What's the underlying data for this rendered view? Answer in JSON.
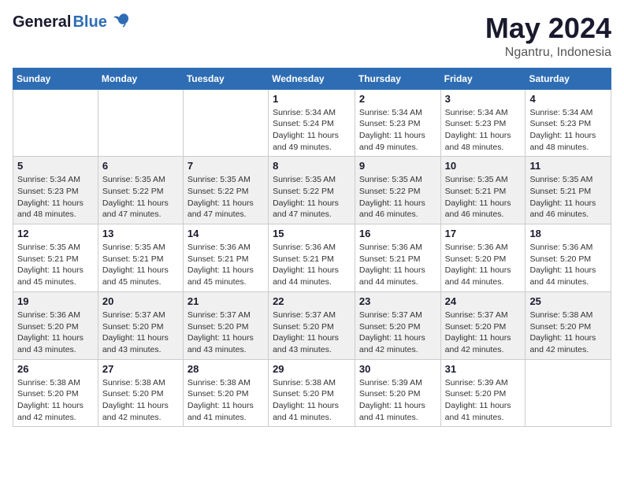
{
  "header": {
    "logo_general": "General",
    "logo_blue": "Blue",
    "month_title": "May 2024",
    "location": "Ngantru, Indonesia"
  },
  "days_of_week": [
    "Sunday",
    "Monday",
    "Tuesday",
    "Wednesday",
    "Thursday",
    "Friday",
    "Saturday"
  ],
  "weeks": [
    [
      {
        "day": "",
        "sunrise": "",
        "sunset": "",
        "daylight": ""
      },
      {
        "day": "",
        "sunrise": "",
        "sunset": "",
        "daylight": ""
      },
      {
        "day": "",
        "sunrise": "",
        "sunset": "",
        "daylight": ""
      },
      {
        "day": "1",
        "sunrise": "Sunrise: 5:34 AM",
        "sunset": "Sunset: 5:24 PM",
        "daylight": "Daylight: 11 hours and 49 minutes."
      },
      {
        "day": "2",
        "sunrise": "Sunrise: 5:34 AM",
        "sunset": "Sunset: 5:23 PM",
        "daylight": "Daylight: 11 hours and 49 minutes."
      },
      {
        "day": "3",
        "sunrise": "Sunrise: 5:34 AM",
        "sunset": "Sunset: 5:23 PM",
        "daylight": "Daylight: 11 hours and 48 minutes."
      },
      {
        "day": "4",
        "sunrise": "Sunrise: 5:34 AM",
        "sunset": "Sunset: 5:23 PM",
        "daylight": "Daylight: 11 hours and 48 minutes."
      }
    ],
    [
      {
        "day": "5",
        "sunrise": "Sunrise: 5:34 AM",
        "sunset": "Sunset: 5:23 PM",
        "daylight": "Daylight: 11 hours and 48 minutes."
      },
      {
        "day": "6",
        "sunrise": "Sunrise: 5:35 AM",
        "sunset": "Sunset: 5:22 PM",
        "daylight": "Daylight: 11 hours and 47 minutes."
      },
      {
        "day": "7",
        "sunrise": "Sunrise: 5:35 AM",
        "sunset": "Sunset: 5:22 PM",
        "daylight": "Daylight: 11 hours and 47 minutes."
      },
      {
        "day": "8",
        "sunrise": "Sunrise: 5:35 AM",
        "sunset": "Sunset: 5:22 PM",
        "daylight": "Daylight: 11 hours and 47 minutes."
      },
      {
        "day": "9",
        "sunrise": "Sunrise: 5:35 AM",
        "sunset": "Sunset: 5:22 PM",
        "daylight": "Daylight: 11 hours and 46 minutes."
      },
      {
        "day": "10",
        "sunrise": "Sunrise: 5:35 AM",
        "sunset": "Sunset: 5:21 PM",
        "daylight": "Daylight: 11 hours and 46 minutes."
      },
      {
        "day": "11",
        "sunrise": "Sunrise: 5:35 AM",
        "sunset": "Sunset: 5:21 PM",
        "daylight": "Daylight: 11 hours and 46 minutes."
      }
    ],
    [
      {
        "day": "12",
        "sunrise": "Sunrise: 5:35 AM",
        "sunset": "Sunset: 5:21 PM",
        "daylight": "Daylight: 11 hours and 45 minutes."
      },
      {
        "day": "13",
        "sunrise": "Sunrise: 5:35 AM",
        "sunset": "Sunset: 5:21 PM",
        "daylight": "Daylight: 11 hours and 45 minutes."
      },
      {
        "day": "14",
        "sunrise": "Sunrise: 5:36 AM",
        "sunset": "Sunset: 5:21 PM",
        "daylight": "Daylight: 11 hours and 45 minutes."
      },
      {
        "day": "15",
        "sunrise": "Sunrise: 5:36 AM",
        "sunset": "Sunset: 5:21 PM",
        "daylight": "Daylight: 11 hours and 44 minutes."
      },
      {
        "day": "16",
        "sunrise": "Sunrise: 5:36 AM",
        "sunset": "Sunset: 5:21 PM",
        "daylight": "Daylight: 11 hours and 44 minutes."
      },
      {
        "day": "17",
        "sunrise": "Sunrise: 5:36 AM",
        "sunset": "Sunset: 5:20 PM",
        "daylight": "Daylight: 11 hours and 44 minutes."
      },
      {
        "day": "18",
        "sunrise": "Sunrise: 5:36 AM",
        "sunset": "Sunset: 5:20 PM",
        "daylight": "Daylight: 11 hours and 44 minutes."
      }
    ],
    [
      {
        "day": "19",
        "sunrise": "Sunrise: 5:36 AM",
        "sunset": "Sunset: 5:20 PM",
        "daylight": "Daylight: 11 hours and 43 minutes."
      },
      {
        "day": "20",
        "sunrise": "Sunrise: 5:37 AM",
        "sunset": "Sunset: 5:20 PM",
        "daylight": "Daylight: 11 hours and 43 minutes."
      },
      {
        "day": "21",
        "sunrise": "Sunrise: 5:37 AM",
        "sunset": "Sunset: 5:20 PM",
        "daylight": "Daylight: 11 hours and 43 minutes."
      },
      {
        "day": "22",
        "sunrise": "Sunrise: 5:37 AM",
        "sunset": "Sunset: 5:20 PM",
        "daylight": "Daylight: 11 hours and 43 minutes."
      },
      {
        "day": "23",
        "sunrise": "Sunrise: 5:37 AM",
        "sunset": "Sunset: 5:20 PM",
        "daylight": "Daylight: 11 hours and 42 minutes."
      },
      {
        "day": "24",
        "sunrise": "Sunrise: 5:37 AM",
        "sunset": "Sunset: 5:20 PM",
        "daylight": "Daylight: 11 hours and 42 minutes."
      },
      {
        "day": "25",
        "sunrise": "Sunrise: 5:38 AM",
        "sunset": "Sunset: 5:20 PM",
        "daylight": "Daylight: 11 hours and 42 minutes."
      }
    ],
    [
      {
        "day": "26",
        "sunrise": "Sunrise: 5:38 AM",
        "sunset": "Sunset: 5:20 PM",
        "daylight": "Daylight: 11 hours and 42 minutes."
      },
      {
        "day": "27",
        "sunrise": "Sunrise: 5:38 AM",
        "sunset": "Sunset: 5:20 PM",
        "daylight": "Daylight: 11 hours and 42 minutes."
      },
      {
        "day": "28",
        "sunrise": "Sunrise: 5:38 AM",
        "sunset": "Sunset: 5:20 PM",
        "daylight": "Daylight: 11 hours and 41 minutes."
      },
      {
        "day": "29",
        "sunrise": "Sunrise: 5:38 AM",
        "sunset": "Sunset: 5:20 PM",
        "daylight": "Daylight: 11 hours and 41 minutes."
      },
      {
        "day": "30",
        "sunrise": "Sunrise: 5:39 AM",
        "sunset": "Sunset: 5:20 PM",
        "daylight": "Daylight: 11 hours and 41 minutes."
      },
      {
        "day": "31",
        "sunrise": "Sunrise: 5:39 AM",
        "sunset": "Sunset: 5:20 PM",
        "daylight": "Daylight: 11 hours and 41 minutes."
      },
      {
        "day": "",
        "sunrise": "",
        "sunset": "",
        "daylight": ""
      }
    ]
  ]
}
